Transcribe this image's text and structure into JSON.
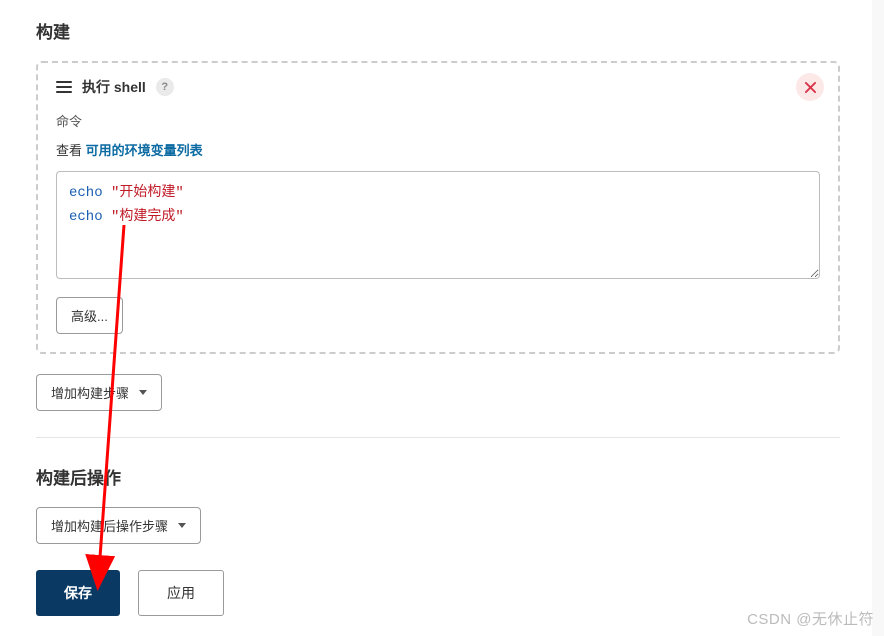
{
  "build": {
    "section_title": "构建",
    "step": {
      "title": "执行 shell",
      "command_label": "命令",
      "env_prefix": "查看 ",
      "env_link": "可用的环境变量列表",
      "code_line1_kw": "echo",
      "code_line1_str": "\"开始构建\"",
      "code_line2_kw": "echo",
      "code_line2_str": "\"构建完成\"",
      "advanced_label": "高级..."
    },
    "add_step_label": "增加构建步骤"
  },
  "post_build": {
    "section_title": "构建后操作",
    "add_step_label": "增加构建后操作步骤"
  },
  "footer": {
    "save_label": "保存",
    "apply_label": "应用"
  },
  "watermark": "CSDN @无休止符",
  "annotation": {
    "color": "#ff0000"
  }
}
